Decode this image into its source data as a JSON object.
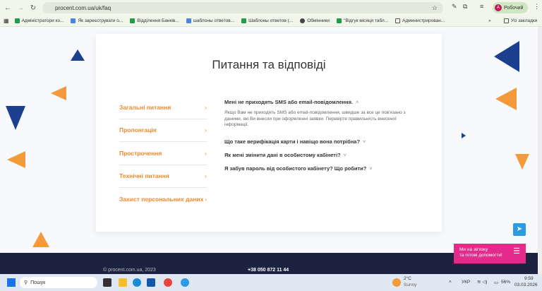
{
  "browser": {
    "url": "procent.com.ua/uk/faq",
    "profile": "Робочий",
    "profile_initial": "A"
  },
  "bookmarks": [
    "Адміністратори ко...",
    "Як зареєструвати о...",
    "Відділення Банків...",
    "шаблоны ответов...",
    "Шаблоны ответов (...",
    "Обмінники",
    "\"Відгук місяця табл...",
    "Администрирован..."
  ],
  "bookmarks_more": "»",
  "all_bookmarks": "Усі закладки",
  "page": {
    "title": "Питання та відповіді",
    "menu": [
      "Загальні питання",
      "Пролонгація",
      "Прострочення",
      "Технічні питання",
      "Захист персональних даних"
    ],
    "faq": [
      {
        "q": "Мені не приходять SMS або email-повідомлення.",
        "a": "Якщо Вам не приходять SMS або email-повідомлення, швидше за все це пов'язано з даними, які Ви внесли при оформленні заявки. Перевірте правильність внесеної інформації.",
        "open": true
      },
      {
        "q": "Що таке верифікація карти і навіщо вона потрібна?",
        "open": false
      },
      {
        "q": "Як мені змінити дані в особистому кабінеті?",
        "open": false
      },
      {
        "q": "Я забув пароль від особистого кабінету? Що робити?",
        "open": false
      }
    ]
  },
  "footer": {
    "copyright": "© procent.com.ua, 2023",
    "phone": "+38 050 872 11 44"
  },
  "chat": {
    "line1": "Ми на зв'язку",
    "line2": "та готові допомогти!"
  },
  "taskbar": {
    "search": "Пошук",
    "weather_temp": "2°C",
    "weather_text": "Sunny",
    "lang": "УКР",
    "battery": "56%",
    "time": "9:59",
    "date": "03.03.2026"
  }
}
